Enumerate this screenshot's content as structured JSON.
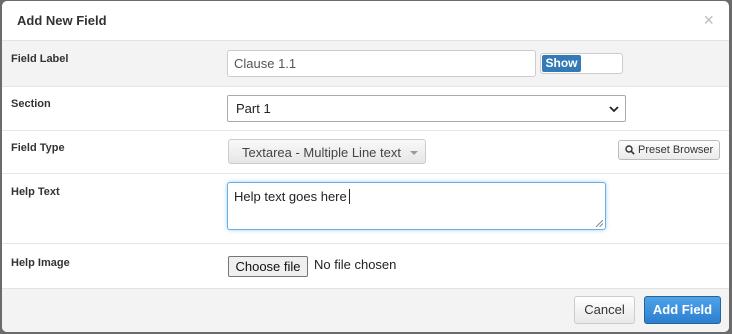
{
  "modal": {
    "title": "Add New Field",
    "close_symbol": "×"
  },
  "fields": {
    "field_label": {
      "label": "Field Label",
      "value": "Clause 1.1",
      "toggle_label": "Show"
    },
    "section": {
      "label": "Section",
      "selected": "Part 1"
    },
    "field_type": {
      "label": "Field Type",
      "selected": "Textarea - Multiple Line text",
      "preset_button": "Preset Browser",
      "preset_icon": "search-icon"
    },
    "help_text": {
      "label": "Help Text",
      "value": "Help text goes here"
    },
    "help_image": {
      "label": "Help Image",
      "button": "Choose file",
      "status": "No file chosen"
    }
  },
  "footer": {
    "cancel_label": "Cancel",
    "submit_label": "Add Field"
  },
  "colors": {
    "primary": "#337ab7",
    "submit": "#2b7fcf",
    "focus_border": "#66afe9"
  }
}
